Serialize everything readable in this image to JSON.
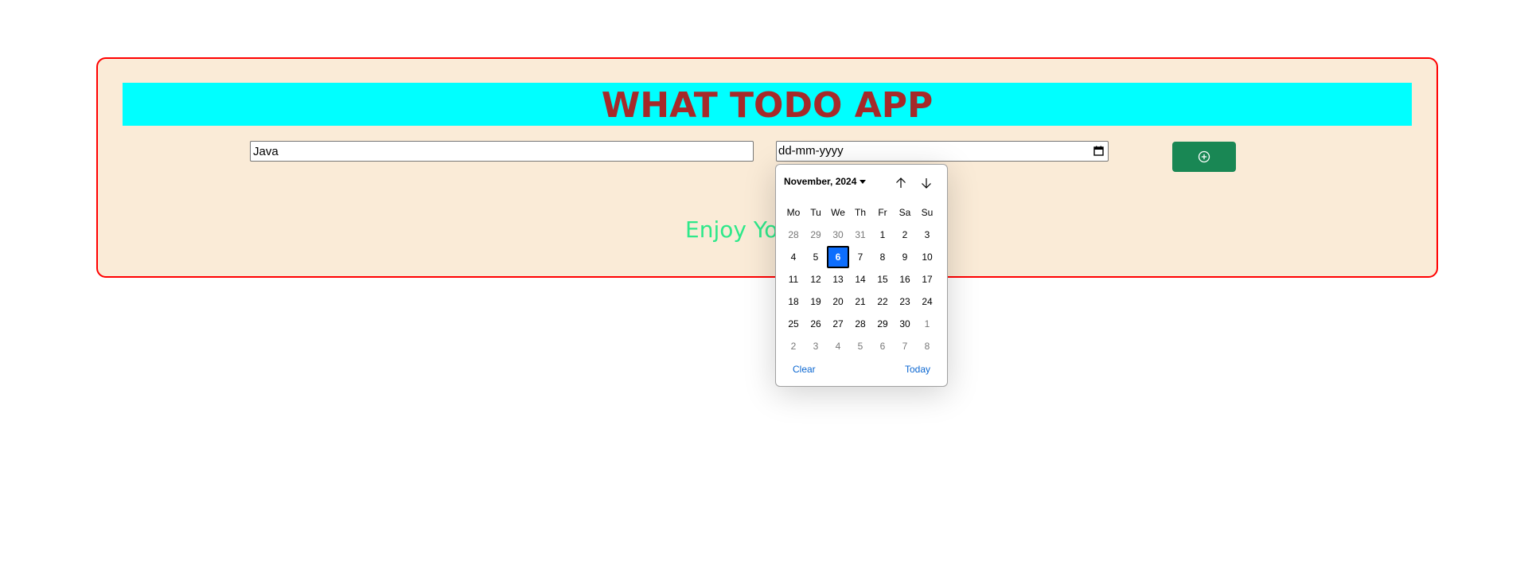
{
  "app": {
    "title": "WHAT TODO APP",
    "todo_input_value": "Java",
    "date_input_placeholder": "dd-mm-yyyy",
    "add_button_icon": "plus-circle-icon",
    "enjoy_message": "Enjoy Yo"
  },
  "colors": {
    "card_bg": "#faebd7",
    "card_border": "#ff0000",
    "title_bg": "#00ffff",
    "title_text": "#a52a2a",
    "add_button": "#198754",
    "enjoy_text": "#2ee88a",
    "selected_day": "#0d6efd"
  },
  "date_picker": {
    "month_label": "November, 2024",
    "prev_icon": "arrow-up-icon",
    "next_icon": "arrow-down-icon",
    "weekdays": [
      "Mo",
      "Tu",
      "We",
      "Th",
      "Fr",
      "Sa",
      "Su"
    ],
    "days": [
      {
        "label": "28",
        "muted": true
      },
      {
        "label": "29",
        "muted": true
      },
      {
        "label": "30",
        "muted": true
      },
      {
        "label": "31",
        "muted": true
      },
      {
        "label": "1"
      },
      {
        "label": "2"
      },
      {
        "label": "3"
      },
      {
        "label": "4"
      },
      {
        "label": "5"
      },
      {
        "label": "6",
        "selected": true
      },
      {
        "label": "7"
      },
      {
        "label": "8"
      },
      {
        "label": "9"
      },
      {
        "label": "10"
      },
      {
        "label": "11"
      },
      {
        "label": "12"
      },
      {
        "label": "13"
      },
      {
        "label": "14"
      },
      {
        "label": "15"
      },
      {
        "label": "16"
      },
      {
        "label": "17"
      },
      {
        "label": "18"
      },
      {
        "label": "19"
      },
      {
        "label": "20"
      },
      {
        "label": "21"
      },
      {
        "label": "22"
      },
      {
        "label": "23"
      },
      {
        "label": "24"
      },
      {
        "label": "25"
      },
      {
        "label": "26"
      },
      {
        "label": "27"
      },
      {
        "label": "28"
      },
      {
        "label": "29"
      },
      {
        "label": "30"
      },
      {
        "label": "1",
        "muted": true
      },
      {
        "label": "2",
        "muted": true
      },
      {
        "label": "3",
        "muted": true
      },
      {
        "label": "4",
        "muted": true
      },
      {
        "label": "5",
        "muted": true
      },
      {
        "label": "6",
        "muted": true
      },
      {
        "label": "7",
        "muted": true
      },
      {
        "label": "8",
        "muted": true
      }
    ],
    "clear_label": "Clear",
    "today_label": "Today"
  }
}
